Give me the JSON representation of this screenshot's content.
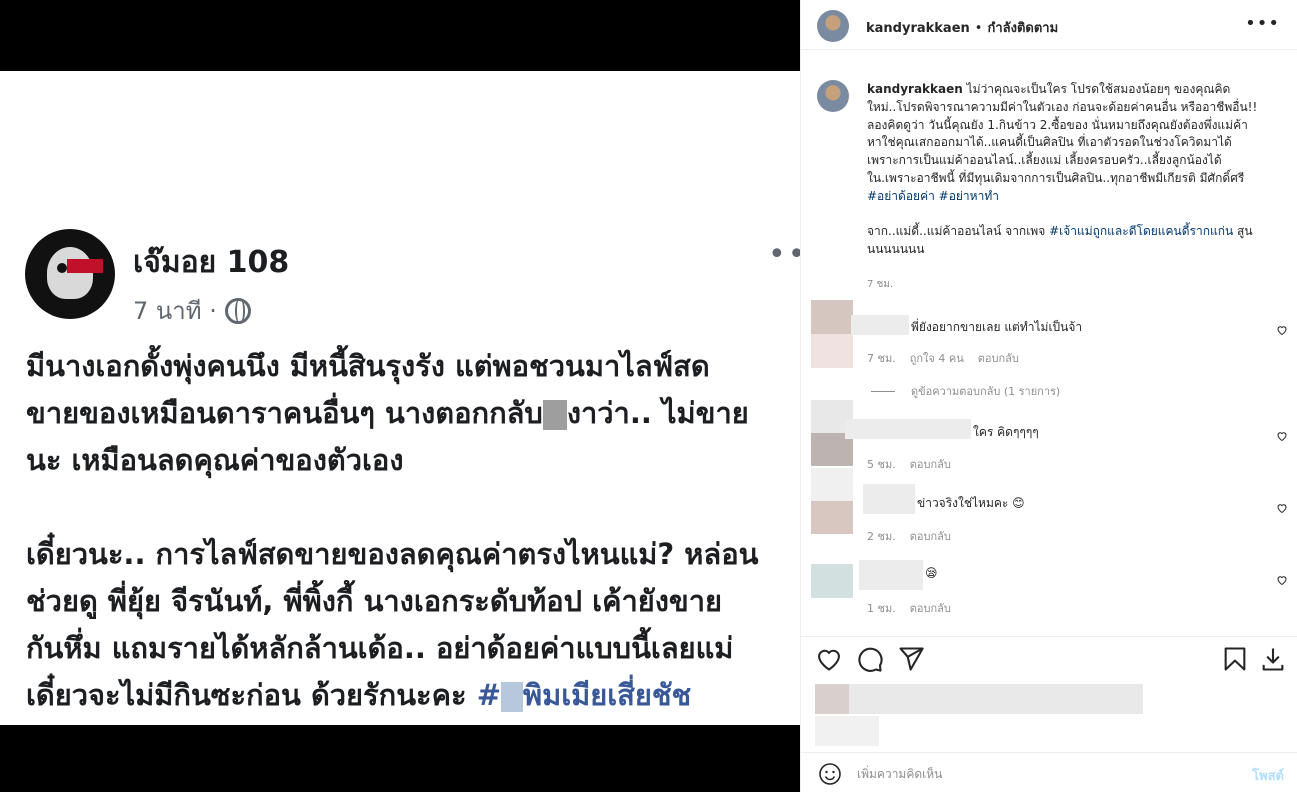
{
  "fb_post": {
    "name": "เจ๊มอย 108",
    "time": "7 นาที ·",
    "paragraph1": [
      "มีนางเอกดั้งพุ่งคนนึง มีหนี้สินรุงรัง แต่พอชวนมาไลฟ์สด",
      "ขายของเหมือนดาราคนอื่นๆ นางตอกกลับ",
      "งาว่า.. ไม่ขาย",
      "นะ เหมือนลดคุณค่าของตัวเอง"
    ],
    "paragraph2": [
      "เดี๋ยวนะ.. การไลฟ์สดขายของลดคุณค่าตรงไหนแม่? หล่อน",
      "ช่วยดู พี่ยุ้ย จีรนันท์, พี่พิ้งกี้ นางเอกระดับท้อป เค้ายังขาย",
      "กันหึ่ม แถมรายได้หลักล้านเด้อ.. อย่าด้อยค่าแบบนี้เลยแม่",
      "เดี๋ยวจะไม่มีกินซะก่อน ด้วยรักนะคะ",
      "#",
      "พิมเมียเสี่ยชัช"
    ]
  },
  "header": {
    "username": "kandyrakkaen",
    "separator": "•",
    "follow_status": "กำลังติดตาม",
    "more": "•••"
  },
  "caption": {
    "username": "kandyrakkaen",
    "lines": [
      "ไม่ว่าคุณจะเป็นใคร โปรดใช้สมองน้อยๆ ของคุณคิด",
      "ใหม่..โปรดพิจารณาความมีค่าในตัวเอง ก่อนจะด้อยค่าคนอื่น หรืออาชีพอื่น!!",
      "ลองคิดดูว่า วันนี้คุณยัง 1.กินข้าว 2.ซื้อของ นั่นหมายถึงคุณยังต้องพึ่งแม่ค้า",
      "หาใช่คุณเสกออกมาได้..แคนดี้เป็นศิลปิน ที่เอาตัวรอดในช่วงโควิดมาได้",
      "เพราะการเป็นแม่ค้าออนไลน์..เลี้ยงแม่ เลี้ยงครอบครัว..เลี้ยงลูกน้องได้",
      "ใน.เพราะอาชีพนี้ ที่มีทุนเดิมจากการเป็นศิลปิน..ทุกอาชีพมีเกียรติ มีศักดิ์ศรี"
    ],
    "hashtags": "#อย่าด้อยค่า #อย่าหาทำ",
    "line_from": "จาก..แม่ดี้..แม่ค้าออนไลน์ จากเพจ",
    "page_tag": "#เจ้าแม่ถูกและดีโดยแคนดี้รากแก่น",
    "line_end": "สูน",
    "line_last": "นนนนนนน",
    "time": "7 ชม."
  },
  "comments": [
    {
      "text": "พี่ยังอยากขายเลย แต่ทำไม่เป็นจ้า",
      "time": "7 ชม.",
      "likes": "ถูกใจ 4 คน",
      "reply": "ตอบกลับ"
    },
    {
      "text": "ใคร คิดๆๆๆๆ",
      "time": "5 ชม.",
      "reply": "ตอบกลับ"
    },
    {
      "text": "ข่าวจริงใช่ไหมคะ 😊",
      "time": "2 ชม.",
      "reply": "ตอบกลับ"
    },
    {
      "text": "😪",
      "time": "1 ชม.",
      "reply": "ตอบกลับ"
    }
  ],
  "view_replies": "ดูข้อความตอบกลับ (1 รายการ)",
  "add_comment": {
    "placeholder": "เพิ่มความคิดเห็น",
    "post_label": "โพสต์"
  },
  "icons": [
    "heart-icon",
    "comment-icon",
    "share-icon",
    "bookmark-icon",
    "download-icon",
    "emoji-icon",
    "globe-icon"
  ],
  "colors": {
    "link": "#00376b",
    "muted": "#8e8e8e",
    "post_disabled": "#b2dffc",
    "fb_link": "#385898"
  }
}
